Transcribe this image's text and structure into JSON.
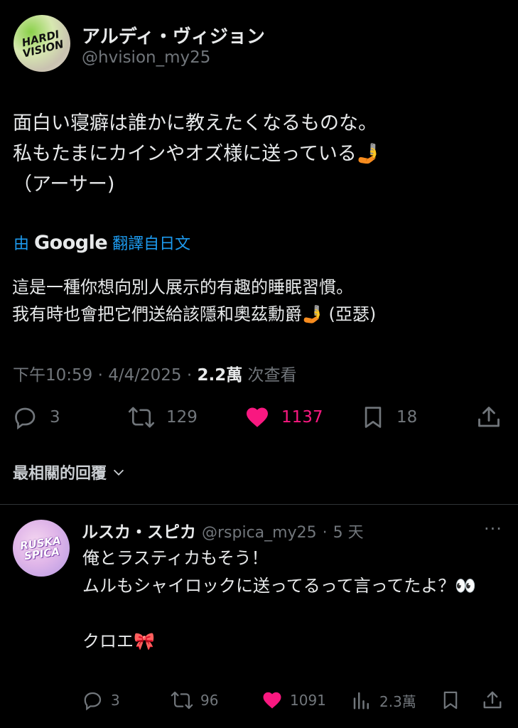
{
  "post": {
    "display_name": "アルディ・ヴィジョン",
    "handle": "@hvision_my25",
    "avatar_text": "HARDI VISION",
    "text_line1": "面白い寝癖は誰かに教えたくなるものな。",
    "text_line2": "私もたまにカインやオズ様に送っている🤳",
    "text_line3": "（アーサー)",
    "translate_prefix": "由",
    "translate_brand": "Google",
    "translate_suffix": "翻譯自日文",
    "translated_line1": "這是一種你想向別人展示的有趣的睡眠習慣。",
    "translated_line2": "我有時也會把它們送給該隱和奧茲勳爵🤳 (亞瑟)",
    "time": "下午10:59",
    "date": "4/4/2025",
    "views_count": "2.2萬",
    "views_label": "次查看",
    "separator": "·",
    "metrics": {
      "replies": "3",
      "reposts": "129",
      "likes": "1137",
      "bookmarks": "18"
    }
  },
  "replies_section": {
    "title": "最相關的回覆",
    "chevron": "⌄"
  },
  "reply": {
    "display_name": "ルスカ・スピカ",
    "handle": "@rspica_my25",
    "separator": "·",
    "time_ago": "5 天",
    "avatar_text": "RUSKA SPICA",
    "more": "···",
    "text": "俺とラスティカもそう！\nムルもシャイロックに送ってるって言ってたよ？👀\n\nクロエ🎀",
    "metrics": {
      "replies": "3",
      "reposts": "96",
      "likes": "1091",
      "views": "2.3萬"
    }
  },
  "colors": {
    "background": "#000000",
    "text": "#e7e9ea",
    "muted": "#71767b",
    "accent_blue": "#1d9bf0",
    "like_pink": "#f91880"
  },
  "icons": [
    "reply-icon",
    "repost-icon",
    "like-icon",
    "bookmark-icon",
    "share-icon",
    "views-icon",
    "more-icon",
    "chevron-down-icon"
  ]
}
